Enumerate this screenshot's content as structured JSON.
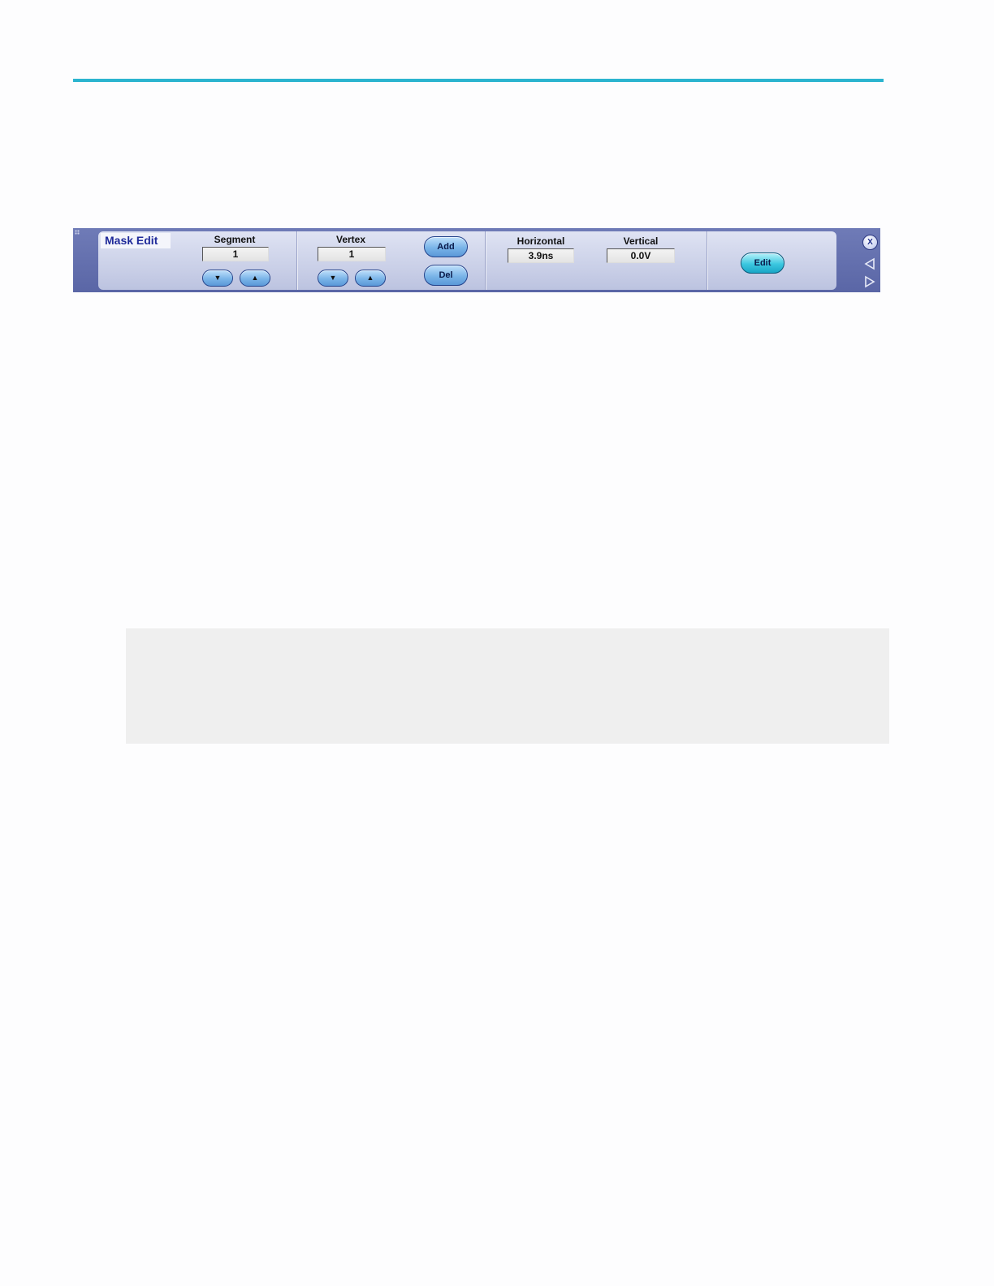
{
  "panel": {
    "title": "Mask Edit",
    "segment": {
      "label": "Segment",
      "value": "1"
    },
    "vertex": {
      "label": "Vertex",
      "value": "1"
    },
    "add_label": "Add",
    "del_label": "Del",
    "horizontal": {
      "label": "Horizontal",
      "value": "3.9ns"
    },
    "vertical": {
      "label": "Vertical",
      "value": "0.0V"
    },
    "edit_label": "Edit",
    "close_label": "X"
  },
  "colors": {
    "rule": "#2bb4cf",
    "panel": "#6f7bb7",
    "accent": "#1f2a9a"
  },
  "icons": [
    "down-arrow-icon",
    "up-arrow-icon",
    "close-icon",
    "left-triangle-icon",
    "right-triangle-icon"
  ]
}
